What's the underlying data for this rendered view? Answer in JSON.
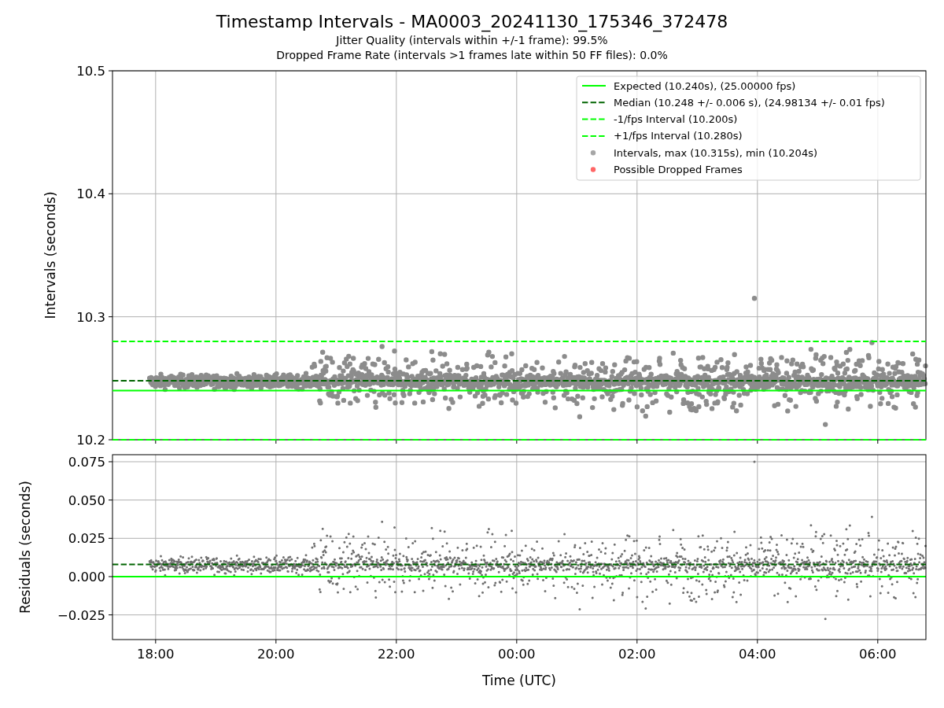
{
  "title": "Timestamp Intervals - MA0003_20241130_175346_372478",
  "subtitles": [
    "Jitter Quality (intervals within +/-1 frame): 99.5%",
    "Dropped Frame Rate (intervals >1 frames late within 50 FF files): 0.0%"
  ],
  "top": {
    "chart_data": {
      "type": "line",
      "grid": true,
      "legend": "upper right",
      "ylabel": "Intervals (seconds)",
      "x": [
        "2024-11-30T17:17",
        "2024-12-01T06:48"
      ],
      "xlim": [
        "2024-11-30T17:17",
        "2024-12-01T06:48"
      ],
      "ylim": [
        10.2,
        10.5
      ],
      "yticks": [
        {
          "value": 10.2,
          "label": "10.2"
        },
        {
          "value": 10.3,
          "label": "10.3"
        },
        {
          "value": 10.4,
          "label": "10.4"
        },
        {
          "value": 10.5,
          "label": "10.5"
        }
      ],
      "series": [
        {
          "name": "Expected (10.240s), (25.00000 fps)",
          "color": "#00ff00",
          "line_style": "solid",
          "values": [
            10.24,
            10.24
          ]
        },
        {
          "name": "Median (10.248 +/- 0.006 s), (24.98134 +/- 0.01 fps)",
          "color": "#006400",
          "line_style": "dashed",
          "values": [
            10.248,
            10.248
          ]
        },
        {
          "name": "-1/fps Interval (10.200s)",
          "color": "#00ff00",
          "line_style": "dashed",
          "values": [
            10.2,
            10.2
          ]
        },
        {
          "name": "+1/fps Interval (10.280s)",
          "color": "#00ff00",
          "line_style": "dashed",
          "values": [
            10.28,
            10.28
          ]
        }
      ]
    },
    "legend_markers": [
      {
        "label": "Intervals, max (10.315s), min (10.204s)",
        "color": "#a6a6a6"
      },
      {
        "label": "Possible Dropped Frames",
        "color": "#ff6666"
      }
    ]
  },
  "bottom": {
    "chart_data": {
      "type": "line",
      "grid": true,
      "xlabel": "Time (UTC)",
      "ylabel": "Residuals (seconds)",
      "x": [
        "2024-11-30T17:17",
        "2024-12-01T06:48"
      ],
      "xlim": [
        "2024-11-30T17:17",
        "2024-12-01T06:48"
      ],
      "ylim": [
        -0.0411,
        0.0796
      ],
      "xticks": [
        {
          "value": "2024-11-30T18:00",
          "label": "18:00"
        },
        {
          "value": "2024-11-30T20:00",
          "label": "20:00"
        },
        {
          "value": "2024-11-30T22:00",
          "label": "22:00"
        },
        {
          "value": "2024-12-01T00:00",
          "label": "00:00"
        },
        {
          "value": "2024-12-01T02:00",
          "label": "02:00"
        },
        {
          "value": "2024-12-01T04:00",
          "label": "04:00"
        },
        {
          "value": "2024-12-01T06:00",
          "label": "06:00"
        }
      ],
      "yticks": [
        {
          "value": -0.025,
          "label": "−0.025"
        },
        {
          "value": 0,
          "label": "0.000"
        },
        {
          "value": 0.025,
          "label": "0.025"
        },
        {
          "value": 0.05,
          "label": "0.050"
        },
        {
          "value": 0.075,
          "label": "0.075"
        }
      ],
      "series": [
        {
          "color": "#00ff00",
          "line_style": "solid",
          "values": [
            0,
            0
          ]
        },
        {
          "color": "#006400",
          "line_style": "dashed",
          "values": [
            0.008,
            0.008
          ]
        }
      ]
    }
  }
}
